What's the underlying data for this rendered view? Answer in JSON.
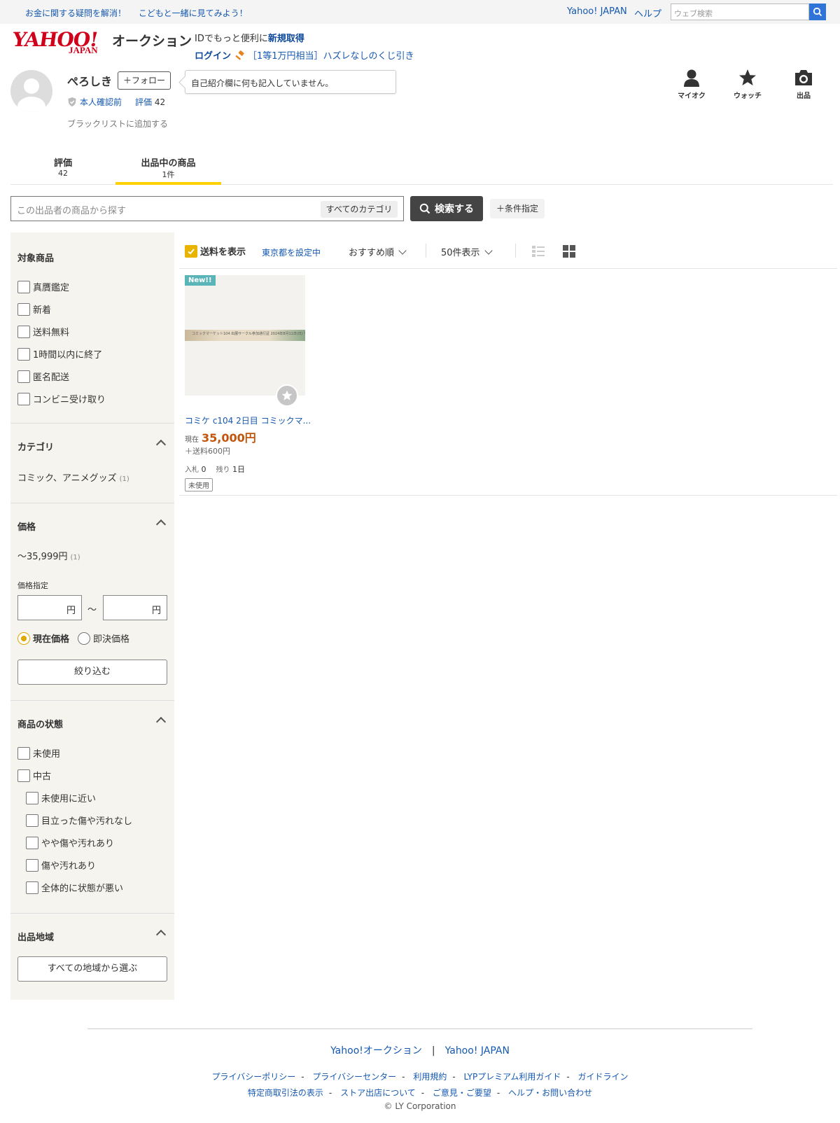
{
  "topbar": {
    "promo1": "お金に関する疑問を解消！",
    "promo2": "こどもと一緒に見てみよう！",
    "yahoo_japan": "Yahoo! JAPAN",
    "help": "ヘルプ",
    "web_search_placeholder": "ウェブ検索"
  },
  "header": {
    "logo_text": "YAHOO!",
    "logo_sub": "JAPAN",
    "service_name": "オークション",
    "login_line1_prefix": "IDでもっと便利に",
    "login_line1_link": "新規取得",
    "login_link": "ログイン",
    "lottery_text": "［1等1万円相当］ハズレなしのくじ引き",
    "icons": [
      {
        "label": "マイオク",
        "icon": "person-icon"
      },
      {
        "label": "ウォッチ",
        "icon": "star-icon"
      },
      {
        "label": "出品",
        "icon": "camera-icon"
      }
    ]
  },
  "seller": {
    "name": "ぺろしき",
    "follow_label": "＋フォロー",
    "verify_label": "本人確認前",
    "rating_label": "評価",
    "rating_value": "42",
    "blacklist_label": "ブラックリストに追加する",
    "bio_bubble": "自己紹介欄に何も記入していません。"
  },
  "tabs": [
    {
      "label": "評価",
      "count": "42"
    },
    {
      "label": "出品中の商品",
      "count": "1件",
      "active": true
    }
  ],
  "search": {
    "placeholder": "この出品者の商品から探す",
    "category_label": "すべてのカテゴリ",
    "button_label": "検索する",
    "conditions_label": "＋条件指定"
  },
  "sidebar": {
    "target_title": "対象商品",
    "target_items": [
      "真贋鑑定",
      "新着",
      "送料無料",
      "1時間以内に終了",
      "匿名配送",
      "コンビニ受け取り"
    ],
    "category_title": "カテゴリ",
    "category_item": "コミック、アニメグッズ",
    "category_count": "(1)",
    "price_title": "価格",
    "price_range": "〜35,999円",
    "price_range_count": "(1)",
    "price_spec_label": "価格指定",
    "price_unit": "円",
    "price_tilde": "〜",
    "price_radio_current": "現在価格",
    "price_radio_buynow": "即決価格",
    "filter_button": "絞り込む",
    "condition_title": "商品の状態",
    "condition_items": [
      "未使用",
      "中古"
    ],
    "condition_subitems": [
      "未使用に近い",
      "目立った傷や汚れなし",
      "やや傷や汚れあり",
      "傷や汚れあり",
      "全体的に状態が悪い"
    ],
    "region_title": "出品地域",
    "region_button": "すべての地域から選ぶ"
  },
  "results": {
    "show_shipping_label": "送料を表示",
    "location_label": "東京都を設定中",
    "sort_label": "おすすめ順",
    "per_page_label": "50件表示"
  },
  "product": {
    "badge": "New!!",
    "image_strip_text": "コミックマーケット104 出展サークル参加通行証 2024年8月11日(日) 午前11時〜午後4時",
    "title": "コミケ c104 2日目 コミックマ...",
    "price_label": "現在",
    "price": "35,000円",
    "shipping": "＋送料600円",
    "bids_label": "入札",
    "bids": "0",
    "remaining_label": "残り",
    "remaining": "1日",
    "condition": "未使用"
  },
  "footer": {
    "main_links": [
      "Yahoo!オークション",
      "Yahoo! JAPAN"
    ],
    "row1": [
      "プライバシーポリシー",
      "プライバシーセンター",
      "利用規約",
      "LYPプレミアム利用ガイド",
      "ガイドライン"
    ],
    "row2": [
      "特定商取引法の表示",
      "ストア出店について",
      "ご意見・ご要望",
      "ヘルプ・お問い合わせ"
    ],
    "copyright": "© LY Corporation"
  },
  "colors": {
    "accent_yellow": "#ffd100",
    "link_blue": "#1558b0",
    "price_orange": "#c2550d",
    "logo_red": "#d0021b",
    "new_badge": "#5bb5b8"
  }
}
